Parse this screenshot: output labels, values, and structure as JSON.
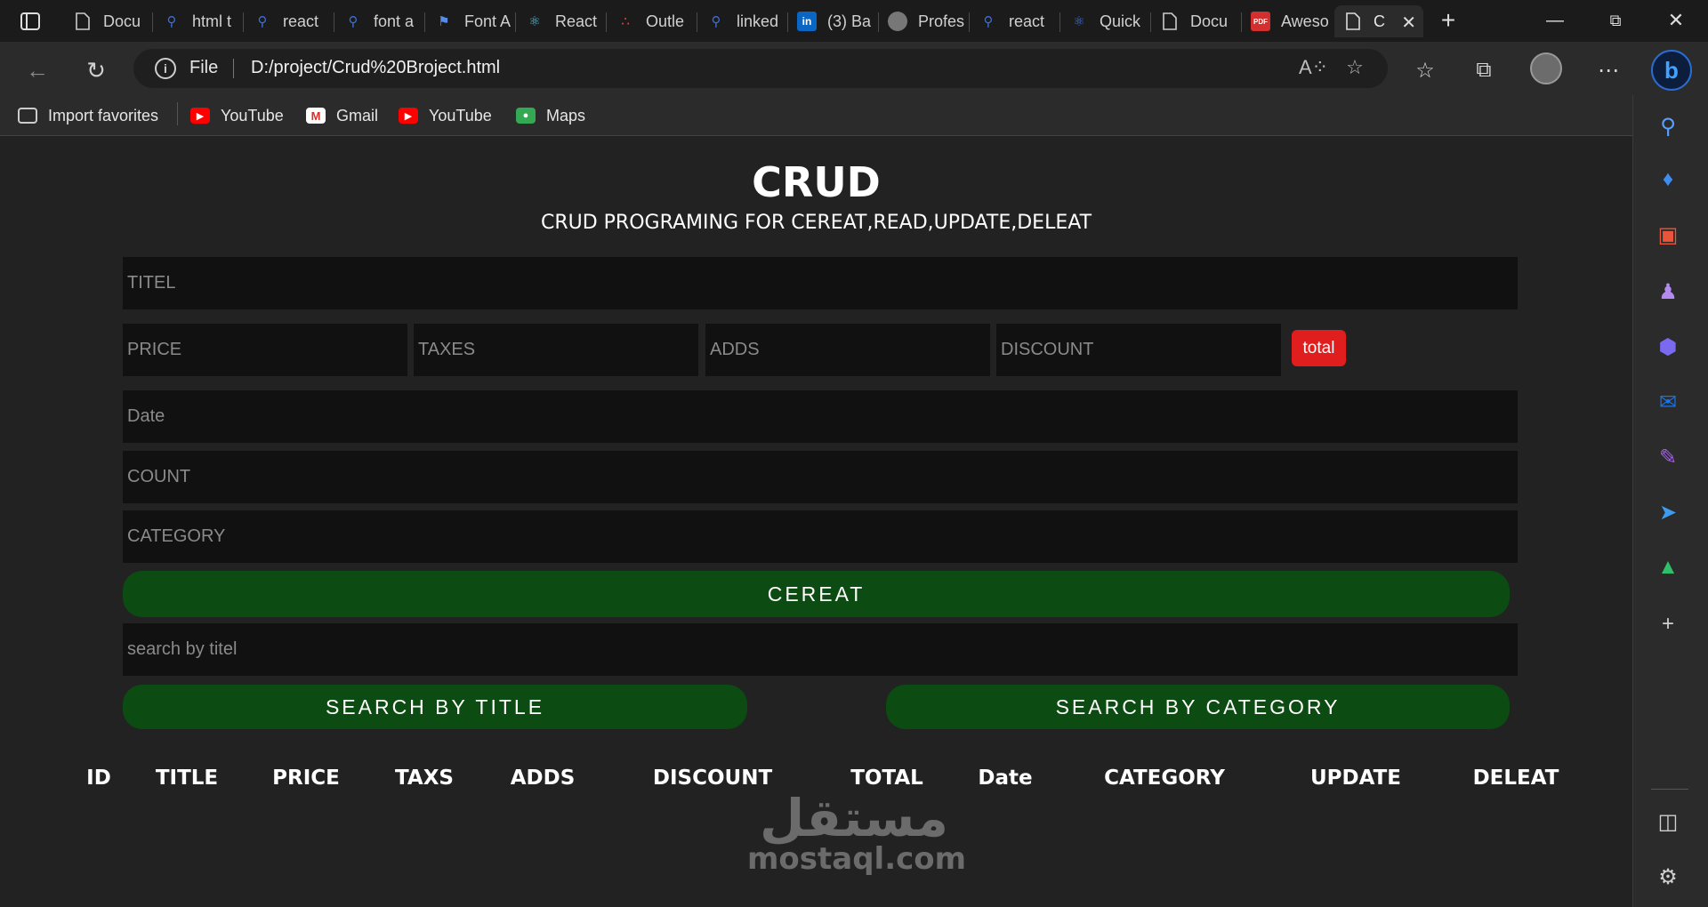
{
  "browser": {
    "tabs": [
      {
        "label": "Docu",
        "icon": "document-icon"
      },
      {
        "label": "html t",
        "icon": "search-icon"
      },
      {
        "label": "react",
        "icon": "search-icon"
      },
      {
        "label": "font a",
        "icon": "search-icon"
      },
      {
        "label": "Font A",
        "icon": "flag-icon"
      },
      {
        "label": "React",
        "icon": "react-icon"
      },
      {
        "label": "Outle",
        "icon": "outlet-icon"
      },
      {
        "label": "linked",
        "icon": "search-icon"
      },
      {
        "label": "(3) Ba",
        "icon": "linkedin-icon"
      },
      {
        "label": "Profes",
        "icon": "profile-icon"
      },
      {
        "label": "react",
        "icon": "search-icon"
      },
      {
        "label": "Quick",
        "icon": "react-icon"
      },
      {
        "label": "Docu",
        "icon": "document-icon"
      },
      {
        "label": "Aweso",
        "icon": "pdf-icon"
      },
      {
        "label": "C",
        "icon": "document-icon"
      }
    ],
    "address": {
      "scheme_label": "File",
      "url": "D:/project/Crud%20Broject.html"
    },
    "favorites": [
      {
        "label": "Import favorites",
        "icon": "import-icon"
      },
      {
        "label": "YouTube",
        "icon": "youtube-icon"
      },
      {
        "label": "Gmail",
        "icon": "gmail-icon"
      },
      {
        "label": "YouTube",
        "icon": "youtube-icon"
      },
      {
        "label": "Maps",
        "icon": "maps-icon"
      }
    ]
  },
  "app": {
    "title": "CRUD",
    "subtitle": "CRUD PROGRAMING FOR CEREAT,READ,UPDATE,DELEAT",
    "form": {
      "title_placeholder": "TITEL",
      "price_placeholder": "PRICE",
      "taxes_placeholder": "TAXES",
      "adds_placeholder": "ADDS",
      "discount_placeholder": "DISCOUNT",
      "total_label": "total",
      "date_placeholder": "Date",
      "count_placeholder": "COUNT",
      "category_placeholder": "CATEGORY",
      "create_label": "CEREAT",
      "search_placeholder": "search by titel",
      "search_title_label": "SEARCH BY TITLE",
      "search_category_label": "SEARCH BY CATEGORY"
    },
    "table_headers": [
      "ID",
      "TITLE",
      "PRICE",
      "TAXS",
      "ADDS",
      "DISCOUNT",
      "TOTAL",
      "Date",
      "CATEGORY",
      "UPDATE",
      "DELEAT"
    ]
  },
  "watermark": {
    "arabic": "مستقل",
    "latin": "mostaql.com"
  },
  "colors": {
    "total_button": "#e01e1e",
    "green_button": "#0c4b12",
    "input_bg": "#111111",
    "page_bg": "#222222"
  }
}
